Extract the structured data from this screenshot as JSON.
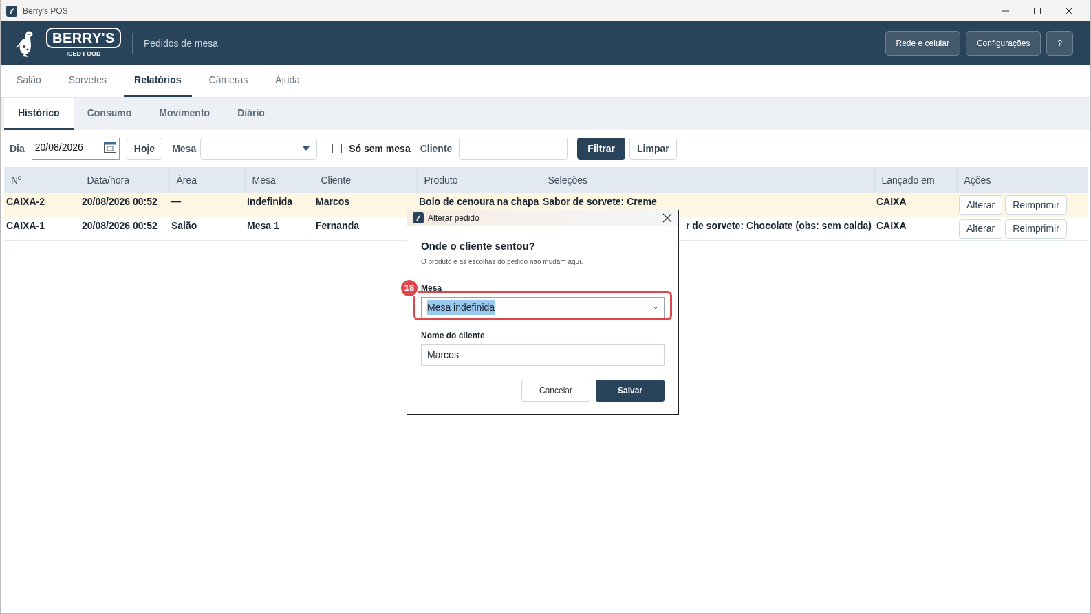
{
  "window": {
    "title": "Berry's POS"
  },
  "header": {
    "logo_text": "BERRY'S",
    "logo_subtext": "ICED FOOD",
    "subtitle": "Pedidos de mesa",
    "buttons": [
      "Rede e celular",
      "Configurações",
      "?"
    ]
  },
  "main_tabs": [
    {
      "label": "Salão",
      "selected": false
    },
    {
      "label": "Sorvetes",
      "selected": false
    },
    {
      "label": "Relatórios",
      "selected": true
    },
    {
      "label": "Câmeras",
      "selected": false
    },
    {
      "label": "Ajuda",
      "selected": false
    }
  ],
  "sub_tabs": [
    {
      "label": "Histórico",
      "selected": true
    },
    {
      "label": "Consumo",
      "selected": false
    },
    {
      "label": "Movimento",
      "selected": false
    },
    {
      "label": "Diário",
      "selected": false
    }
  ],
  "filters": {
    "day_label": "Dia",
    "day_value": "20/08/2026",
    "today_button": "Hoje",
    "table_label": "Mesa",
    "only_without_table": {
      "label": "Só sem mesa",
      "checked": false
    },
    "client_label": "Cliente",
    "filter_button": "Filtrar",
    "clear_button": "Limpar"
  },
  "table": {
    "columns": [
      "Nº",
      "Data/hora",
      "Área",
      "Mesa",
      "Cliente",
      "Produto",
      "Seleções",
      "Lançado em",
      "Ações"
    ],
    "rows": [
      {
        "selected": true,
        "number": "CAIXA-2",
        "datetime": "20/08/2026 00:52",
        "area": "—",
        "table": "Indefinida",
        "client": "Marcos",
        "product": "Bolo de cenoura na chapa",
        "selections": "Sabor de sorvete: Creme",
        "launched_in": "CAIXA",
        "actions": [
          "Alterar",
          "Reimprimir"
        ]
      },
      {
        "selected": false,
        "number": "CAIXA-1",
        "datetime": "20/08/2026 00:52",
        "area": "Salão",
        "table": "Mesa 1",
        "client": "Fernanda",
        "selections": "r de sorvete: Chocolate (obs: sem calda)",
        "launched_in": "CAIXA",
        "actions": [
          "Alterar",
          "Reimprimir"
        ]
      }
    ]
  },
  "dialog": {
    "title": "Alterar pedido",
    "heading": "Onde o cliente sentou?",
    "note": "O produto e as escolhas do pedido não mudam aqui.",
    "table_label": "Mesa",
    "table_value": "Mesa indefinida",
    "client_label": "Nome do cliente",
    "client_value": "Marcos",
    "buttons": [
      {
        "label": "Cancelar",
        "kind": "secondary"
      },
      {
        "label": "Salvar",
        "kind": "primary"
      }
    ]
  },
  "annotation": {
    "number": "18"
  }
}
